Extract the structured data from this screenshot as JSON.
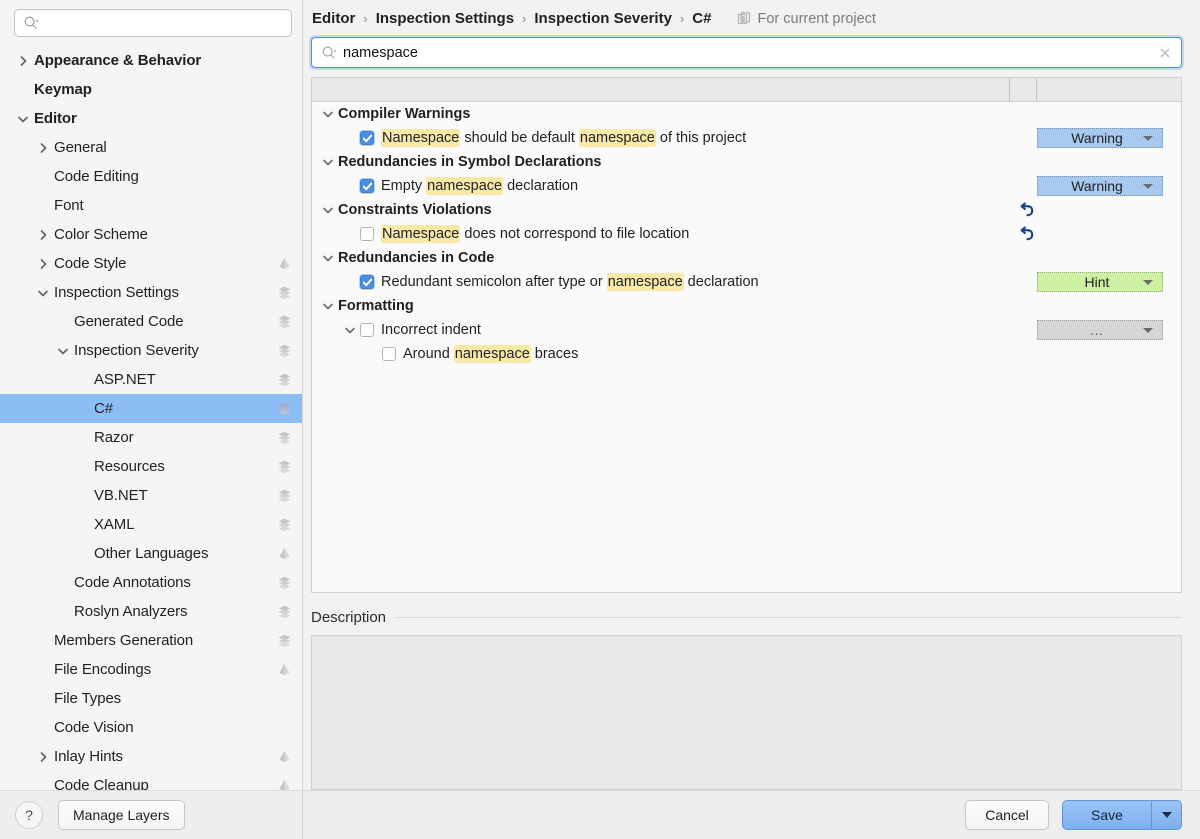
{
  "sidebar": {
    "search": {
      "placeholder": "",
      "value": "",
      "icon": "search-icon"
    },
    "items": [
      {
        "label": "Appearance & Behavior",
        "depth": 0,
        "bold": true,
        "chevron": "right",
        "icon": ""
      },
      {
        "label": "Keymap",
        "depth": 0,
        "bold": true,
        "chevron": "",
        "icon": ""
      },
      {
        "label": "Editor",
        "depth": 0,
        "bold": true,
        "chevron": "down",
        "icon": ""
      },
      {
        "label": "General",
        "depth": 1,
        "bold": false,
        "chevron": "right",
        "icon": ""
      },
      {
        "label": "Code Editing",
        "depth": 1,
        "bold": false,
        "chevron": "",
        "icon": ""
      },
      {
        "label": "Font",
        "depth": 1,
        "bold": false,
        "chevron": "",
        "icon": ""
      },
      {
        "label": "Color Scheme",
        "depth": 1,
        "bold": false,
        "chevron": "right",
        "icon": ""
      },
      {
        "label": "Code Style",
        "depth": 1,
        "bold": false,
        "chevron": "right",
        "icon": "diamond"
      },
      {
        "label": "Inspection Settings",
        "depth": 1,
        "bold": false,
        "chevron": "down",
        "icon": "layers"
      },
      {
        "label": "Generated Code",
        "depth": 2,
        "bold": false,
        "chevron": "",
        "icon": "layers"
      },
      {
        "label": "Inspection Severity",
        "depth": 2,
        "bold": false,
        "chevron": "down",
        "icon": "layers"
      },
      {
        "label": "ASP.NET",
        "depth": 3,
        "bold": false,
        "chevron": "",
        "icon": "layers"
      },
      {
        "label": "C#",
        "depth": 3,
        "bold": false,
        "chevron": "",
        "icon": "layers",
        "selected": true
      },
      {
        "label": "Razor",
        "depth": 3,
        "bold": false,
        "chevron": "",
        "icon": "layers"
      },
      {
        "label": "Resources",
        "depth": 3,
        "bold": false,
        "chevron": "",
        "icon": "layers"
      },
      {
        "label": "VB.NET",
        "depth": 3,
        "bold": false,
        "chevron": "",
        "icon": "layers"
      },
      {
        "label": "XAML",
        "depth": 3,
        "bold": false,
        "chevron": "",
        "icon": "layers"
      },
      {
        "label": "Other Languages",
        "depth": 3,
        "bold": false,
        "chevron": "",
        "icon": "diamond"
      },
      {
        "label": "Code Annotations",
        "depth": 2,
        "bold": false,
        "chevron": "",
        "icon": "layers"
      },
      {
        "label": "Roslyn Analyzers",
        "depth": 2,
        "bold": false,
        "chevron": "",
        "icon": "layers"
      },
      {
        "label": "Members Generation",
        "depth": 1,
        "bold": false,
        "chevron": "",
        "icon": "layers"
      },
      {
        "label": "File Encodings",
        "depth": 1,
        "bold": false,
        "chevron": "",
        "icon": "diamond"
      },
      {
        "label": "File Types",
        "depth": 1,
        "bold": false,
        "chevron": "",
        "icon": ""
      },
      {
        "label": "Code Vision",
        "depth": 1,
        "bold": false,
        "chevron": "",
        "icon": ""
      },
      {
        "label": "Inlay Hints",
        "depth": 1,
        "bold": false,
        "chevron": "right",
        "icon": "diamond"
      },
      {
        "label": "Code Cleanup",
        "depth": 1,
        "bold": false,
        "chevron": "",
        "icon": "diamond"
      }
    ],
    "footer": {
      "help_label": "?",
      "manage_layers_label": "Manage Layers"
    }
  },
  "main": {
    "breadcrumb": [
      "Editor",
      "Inspection Settings",
      "Inspection Severity",
      "C#"
    ],
    "breadcrumb_separator": "›",
    "scope": {
      "label": "For current project",
      "icon": "project-scope-icon"
    },
    "search": {
      "value": "namespace",
      "placeholder": "",
      "icon": "search-icon",
      "clear_icon": "close-icon"
    },
    "rows": [
      {
        "kind": "group",
        "label": "Compiler Warnings",
        "chevron": "down",
        "depth": 0
      },
      {
        "kind": "item",
        "depth": 1,
        "checked": true,
        "chevron": "",
        "parts": [
          {
            "t": "Namespace",
            "hl": true
          },
          {
            "t": " should be default ",
            "hl": false
          },
          {
            "t": "namespace",
            "hl": true
          },
          {
            "t": " of this project",
            "hl": false
          }
        ],
        "severity": {
          "label": "Warning",
          "style": "warning"
        },
        "revert": false
      },
      {
        "kind": "group",
        "label": "Redundancies in Symbol Declarations",
        "chevron": "down",
        "depth": 0
      },
      {
        "kind": "item",
        "depth": 1,
        "checked": true,
        "chevron": "",
        "parts": [
          {
            "t": "Empty ",
            "hl": false
          },
          {
            "t": "namespace",
            "hl": true
          },
          {
            "t": " declaration",
            "hl": false
          }
        ],
        "severity": {
          "label": "Warning",
          "style": "warning"
        },
        "revert": false
      },
      {
        "kind": "group",
        "label": "Constraints Violations",
        "chevron": "down",
        "depth": 0,
        "revert": true
      },
      {
        "kind": "item",
        "depth": 1,
        "checked": false,
        "chevron": "",
        "parts": [
          {
            "t": "Namespace",
            "hl": true
          },
          {
            "t": " does not correspond to file location",
            "hl": false
          }
        ],
        "severity": null,
        "revert": true
      },
      {
        "kind": "group",
        "label": "Redundancies in Code",
        "chevron": "down",
        "depth": 0
      },
      {
        "kind": "item",
        "depth": 1,
        "checked": true,
        "chevron": "",
        "parts": [
          {
            "t": "Redundant semicolon after type or ",
            "hl": false
          },
          {
            "t": "namespace",
            "hl": true
          },
          {
            "t": " declaration",
            "hl": false
          }
        ],
        "severity": {
          "label": "Hint",
          "style": "hint"
        },
        "revert": false
      },
      {
        "kind": "group",
        "label": "Formatting",
        "chevron": "down",
        "depth": 0
      },
      {
        "kind": "item",
        "depth": 1,
        "checked": false,
        "chevron": "down",
        "parts": [
          {
            "t": "Incorrect indent",
            "hl": false
          }
        ],
        "severity": {
          "label": "…",
          "style": "muted"
        },
        "revert": false
      },
      {
        "kind": "item",
        "depth": 2,
        "checked": false,
        "chevron": "",
        "parts": [
          {
            "t": "Around ",
            "hl": false
          },
          {
            "t": "namespace",
            "hl": true
          },
          {
            "t": " braces",
            "hl": false
          }
        ],
        "severity": null,
        "revert": false
      }
    ],
    "description": {
      "label": "Description",
      "content": ""
    },
    "footer": {
      "cancel_label": "Cancel",
      "save_label": "Save"
    }
  },
  "colors": {
    "selection_blue": "#8cbdf5",
    "severity_warning": "#a8c9f0",
    "severity_hint": "#cdf0a2",
    "severity_muted": "#d6d6d6",
    "highlight_yellow": "#fbe9a8",
    "checkbox_checked": "#4a90e2",
    "revert_arrow": "#1c3f94",
    "save_button": "#7db0ef"
  }
}
